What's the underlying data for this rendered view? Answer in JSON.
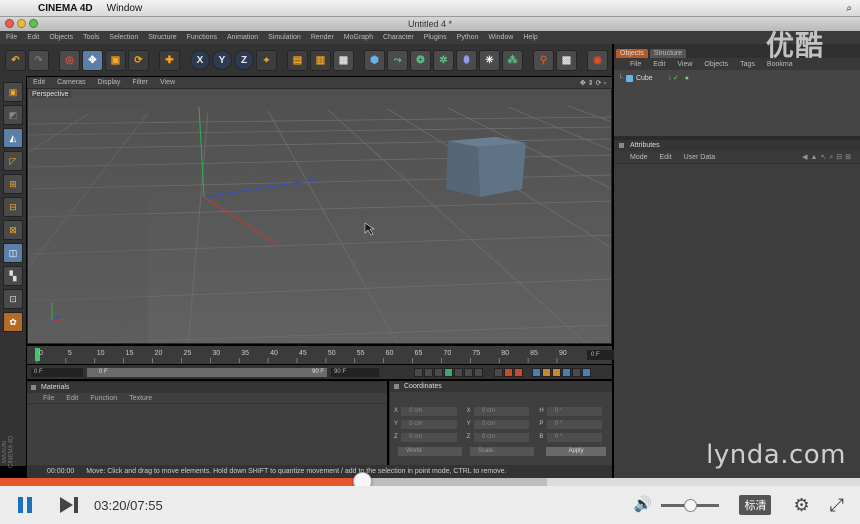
{
  "mac_menubar": {
    "app": "CINEMA 4D",
    "menu": "Window"
  },
  "window": {
    "title": "Untitled 4 *"
  },
  "c4d_menu": [
    "File",
    "Edit",
    "Objects",
    "Tools",
    "Selection",
    "Structure",
    "Functions",
    "Animation",
    "Simulation",
    "Render",
    "MoGraph",
    "Character",
    "Plugins",
    "Python",
    "Window",
    "Help"
  ],
  "toolbar": {
    "axes": [
      "X",
      "Y",
      "Z"
    ]
  },
  "viewport": {
    "menu": [
      "Edit",
      "Cameras",
      "Display",
      "Filter",
      "View"
    ],
    "camera_label": "Perspective"
  },
  "timeline": {
    "ticks": [
      "0",
      "5",
      "10",
      "15",
      "20",
      "25",
      "30",
      "35",
      "40",
      "45",
      "50",
      "55",
      "60",
      "65",
      "70",
      "75",
      "80",
      "85",
      "90"
    ],
    "current_frame": "0 F",
    "start_field": "0 F",
    "range_start": "0 F",
    "range_end": "90 F",
    "end_field": "90 F"
  },
  "materials": {
    "title": "Materials",
    "menu": [
      "File",
      "Edit",
      "Function",
      "Texture"
    ]
  },
  "coordinates": {
    "title": "Coordinates",
    "rows": [
      {
        "a": "X",
        "av": "0 cm",
        "b": "X",
        "bv": "0 cm",
        "c": "H",
        "cv": "0 °"
      },
      {
        "a": "Y",
        "av": "0 cm",
        "b": "Y",
        "bv": "0 cm",
        "c": "P",
        "cv": "0 °"
      },
      {
        "a": "Z",
        "av": "0 cm",
        "b": "Z",
        "bv": "0 cm",
        "c": "B",
        "cv": "0 °"
      }
    ],
    "mode_select": "World",
    "scale_select": "Scale",
    "apply_label": "Apply"
  },
  "status": {
    "time": "00:00:00",
    "message": "Move: Click and drag to move elements. Hold down SHIFT to quantize movement / add to the selection in point mode, CTRL to remove."
  },
  "objects": {
    "tabs": [
      "Objects",
      "Structure"
    ],
    "menu": [
      "File",
      "Edit",
      "View",
      "Objects",
      "Tags",
      "Bookma"
    ],
    "items": [
      {
        "name": "Cube"
      }
    ]
  },
  "attributes": {
    "title": "Attributes",
    "menu": [
      "Mode",
      "Edit",
      "User Data"
    ]
  },
  "watermarks": {
    "youku": "优酷",
    "lynda": "lynda.com",
    "maxon": "MAXON CINEMA 4D"
  },
  "player": {
    "time": "03:20/07:55",
    "progress": 0.4206,
    "buffered": 0.636,
    "volume": 0.5,
    "quality_label": "标清"
  }
}
